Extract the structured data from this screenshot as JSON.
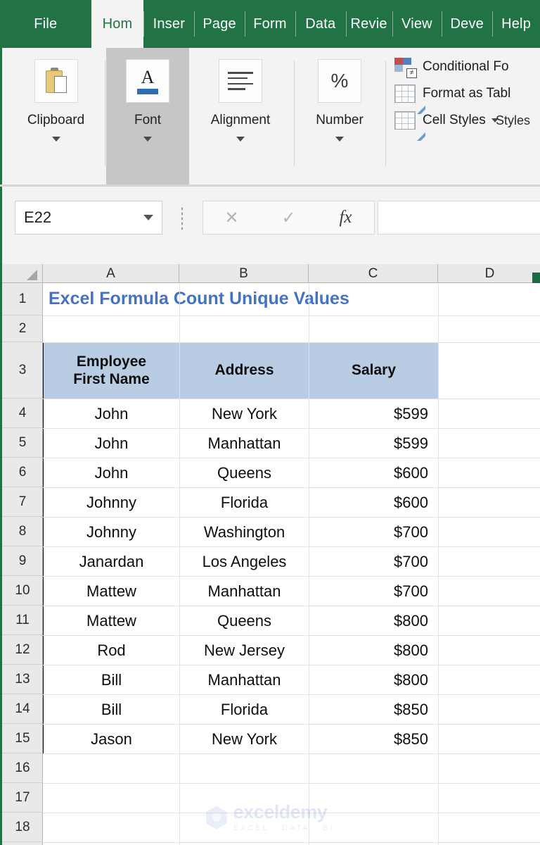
{
  "ribbon": {
    "tabs": [
      {
        "label": "File",
        "active": false
      },
      {
        "label": "Hom",
        "active": true
      },
      {
        "label": "Inser",
        "active": false
      },
      {
        "label": "Page",
        "active": false
      },
      {
        "label": "Form",
        "active": false
      },
      {
        "label": "Data",
        "active": false
      },
      {
        "label": "Revie",
        "active": false
      },
      {
        "label": "View",
        "active": false
      },
      {
        "label": "Deve",
        "active": false
      },
      {
        "label": "Help",
        "active": false
      }
    ],
    "groups": [
      {
        "label": "Clipboard",
        "icon": "clipboard-icon"
      },
      {
        "label": "Font",
        "icon": "font-icon"
      },
      {
        "label": "Alignment",
        "icon": "alignment-icon"
      },
      {
        "label": "Number",
        "icon": "percent-icon"
      }
    ],
    "styles": {
      "items": [
        {
          "label": "Conditional Fo",
          "icon": "conditional-formatting-icon"
        },
        {
          "label": "Format as Tabl",
          "icon": "format-as-table-icon"
        },
        {
          "label": "Cell Styles",
          "icon": "cell-styles-icon",
          "caret": true
        }
      ],
      "group_caption": "Styles"
    }
  },
  "formula_bar": {
    "name_box_value": "E22",
    "cancel_icon": "✕",
    "confirm_icon": "✓",
    "function_icon": "fx",
    "formula_value": "",
    "formula_placeholder": ""
  },
  "grid": {
    "columns": [
      "A",
      "B",
      "C",
      "D"
    ],
    "rows": [
      "1",
      "2",
      "3",
      "4",
      "5",
      "6",
      "7",
      "8",
      "9",
      "10",
      "11",
      "12",
      "13",
      "14",
      "15",
      "16",
      "17",
      "18"
    ],
    "title_cell": {
      "ref": "A1",
      "text": "Excel Formula Count Unique Values",
      "color": "#4472c4"
    },
    "table": {
      "header_fill": "#b8cce4",
      "headers": [
        "Employee First Name",
        "Address",
        "Salary"
      ],
      "header_lines": [
        [
          "Employee",
          "First Name"
        ],
        [
          "Address"
        ],
        [
          "Salary"
        ]
      ],
      "rows": [
        {
          "name": "John",
          "address": "New York",
          "salary": "$599"
        },
        {
          "name": "John",
          "address": "Manhattan",
          "salary": "$599"
        },
        {
          "name": "John",
          "address": "Queens",
          "salary": "$600"
        },
        {
          "name": "Johnny",
          "address": "Florida",
          "salary": "$600"
        },
        {
          "name": "Johnny",
          "address": "Washington",
          "salary": "$700"
        },
        {
          "name": "Janardan",
          "address": "Los Angeles",
          "salary": "$700"
        },
        {
          "name": "Mattew",
          "address": "Manhattan",
          "salary": "$700"
        },
        {
          "name": "Mattew",
          "address": "Queens",
          "salary": "$800"
        },
        {
          "name": "Rod",
          "address": "New Jersey",
          "salary": "$800"
        },
        {
          "name": "Bill",
          "address": "Manhattan",
          "salary": "$800"
        },
        {
          "name": "Bill",
          "address": "Florida",
          "salary": "$850"
        },
        {
          "name": "Jason",
          "address": "New York",
          "salary": "$850"
        }
      ]
    }
  },
  "watermark": {
    "name": "exceldemy",
    "tagline": "EXCEL · DATA · BI"
  },
  "theme": {
    "ribbon_green": "#217346",
    "header_blue": "#b8cce4",
    "title_blue": "#4472c4"
  }
}
